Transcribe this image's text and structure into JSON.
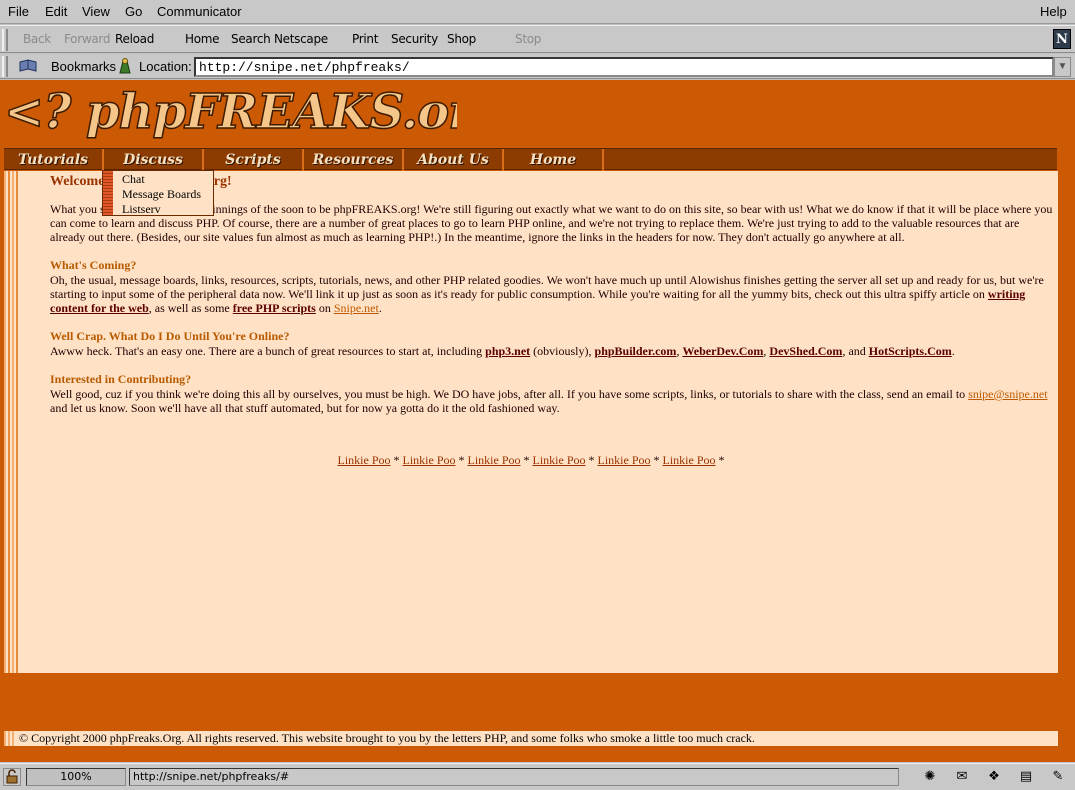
{
  "menubar": {
    "items": [
      "File",
      "Edit",
      "View",
      "Go",
      "Communicator"
    ],
    "help": "Help"
  },
  "toolbar": {
    "back": "Back",
    "forward": "Forward",
    "reload": "Reload",
    "home": "Home",
    "search": "Search",
    "netscape": "Netscape",
    "print": "Print",
    "security": "Security",
    "shop": "Shop",
    "stop": "Stop",
    "logo": "N"
  },
  "location": {
    "bookmarks_label": "Bookmarks",
    "location_label": "Location:",
    "url": "http://snipe.net/phpfreaks/"
  },
  "site": {
    "logo_text": "<? phpFREAKS.org ?>",
    "nav": [
      "Tutorials",
      "Discuss",
      "Scripts",
      "Resources",
      "About Us",
      "Home"
    ],
    "dropdown": [
      "Chat",
      "Message Boards",
      "Listserv"
    ],
    "welcome_heading": "Welcome to phpFREAKS.org!",
    "intro": {
      "t1": "What you see here is the very beginnings of the soon to be phpFREAKS.org! We're still figuring out exactly what we want to do on this site, so bear with us! What we do know if that it will be place where you can come to learn and discuss PHP. Of course, there are a number of great places to go to learn PHP online, and we're not trying to replace them. We're just trying to add to the valuable resources that are already out there. (Besides, our site values fun almost as much as learning PHP!.) In the meantime, ignore the links in the headers for now. They don't actually go anywhere at all."
    },
    "coming": {
      "heading": "What's Coming?",
      "t1": "Oh, the usual, message boards, links, resources, scripts, tutorials, news, and other PHP related goodies. We won't have much up until Alowishus finishes getting the server all set up and ready for us, but we're starting to input some of the peripheral data now. We'll link it up just as soon as it's ready for public consumption. While you're waiting for all the yummy bits, check out this ultra spiffy article on ",
      "link1": "writing content for the web",
      "t2": ", as well as some ",
      "link2": "free PHP scripts",
      "t3": " on ",
      "link3": "Snipe.net",
      "t4": "."
    },
    "crap": {
      "heading": "Well Crap. What Do I Do Until You're Online?",
      "t1": "Awww heck. That's an easy one. There are a bunch of great resources to start at, including ",
      "l1": "php3.net",
      "t2": " (obviously), ",
      "l2": "phpBuilder.com",
      "t3": ", ",
      "l3": "WeberDev.Com",
      "t4": ", ",
      "l4": "DevShed.Com",
      "t5": ", and ",
      "l5": "HotScripts.Com",
      "t6": "."
    },
    "contrib": {
      "heading": "Interested in Contributing?",
      "t1": "Well good, cuz if you think we're doing this all by ourselves, you must be high. We DO have jobs, after all. If you have some scripts, links, or tutorials to share with the class, send an email to ",
      "email": "snipe@snipe.net",
      "t2": " and let us know. Soon we'll have all that stuff automated, but for now ya gotta do it the old fashioned way."
    },
    "link_row": [
      "Linkie Poo",
      "Linkie Poo",
      "Linkie Poo",
      "Linkie Poo",
      "Linkie Poo",
      "Linkie Poo"
    ],
    "link_sep": "*",
    "footer": "© Copyright 2000 phpFreaks.Org. All rights reserved. This website brought to you by the letters PHP, and some folks who smoke a little too much crack."
  },
  "status": {
    "progress": "100%",
    "message": "http://snipe.net/phpfreaks/#"
  },
  "colors": {
    "page_bg": "#cc5a04",
    "content_bg": "#ffe2c6",
    "nav_bg": "#8c3c00",
    "heading": "#b85a00"
  }
}
